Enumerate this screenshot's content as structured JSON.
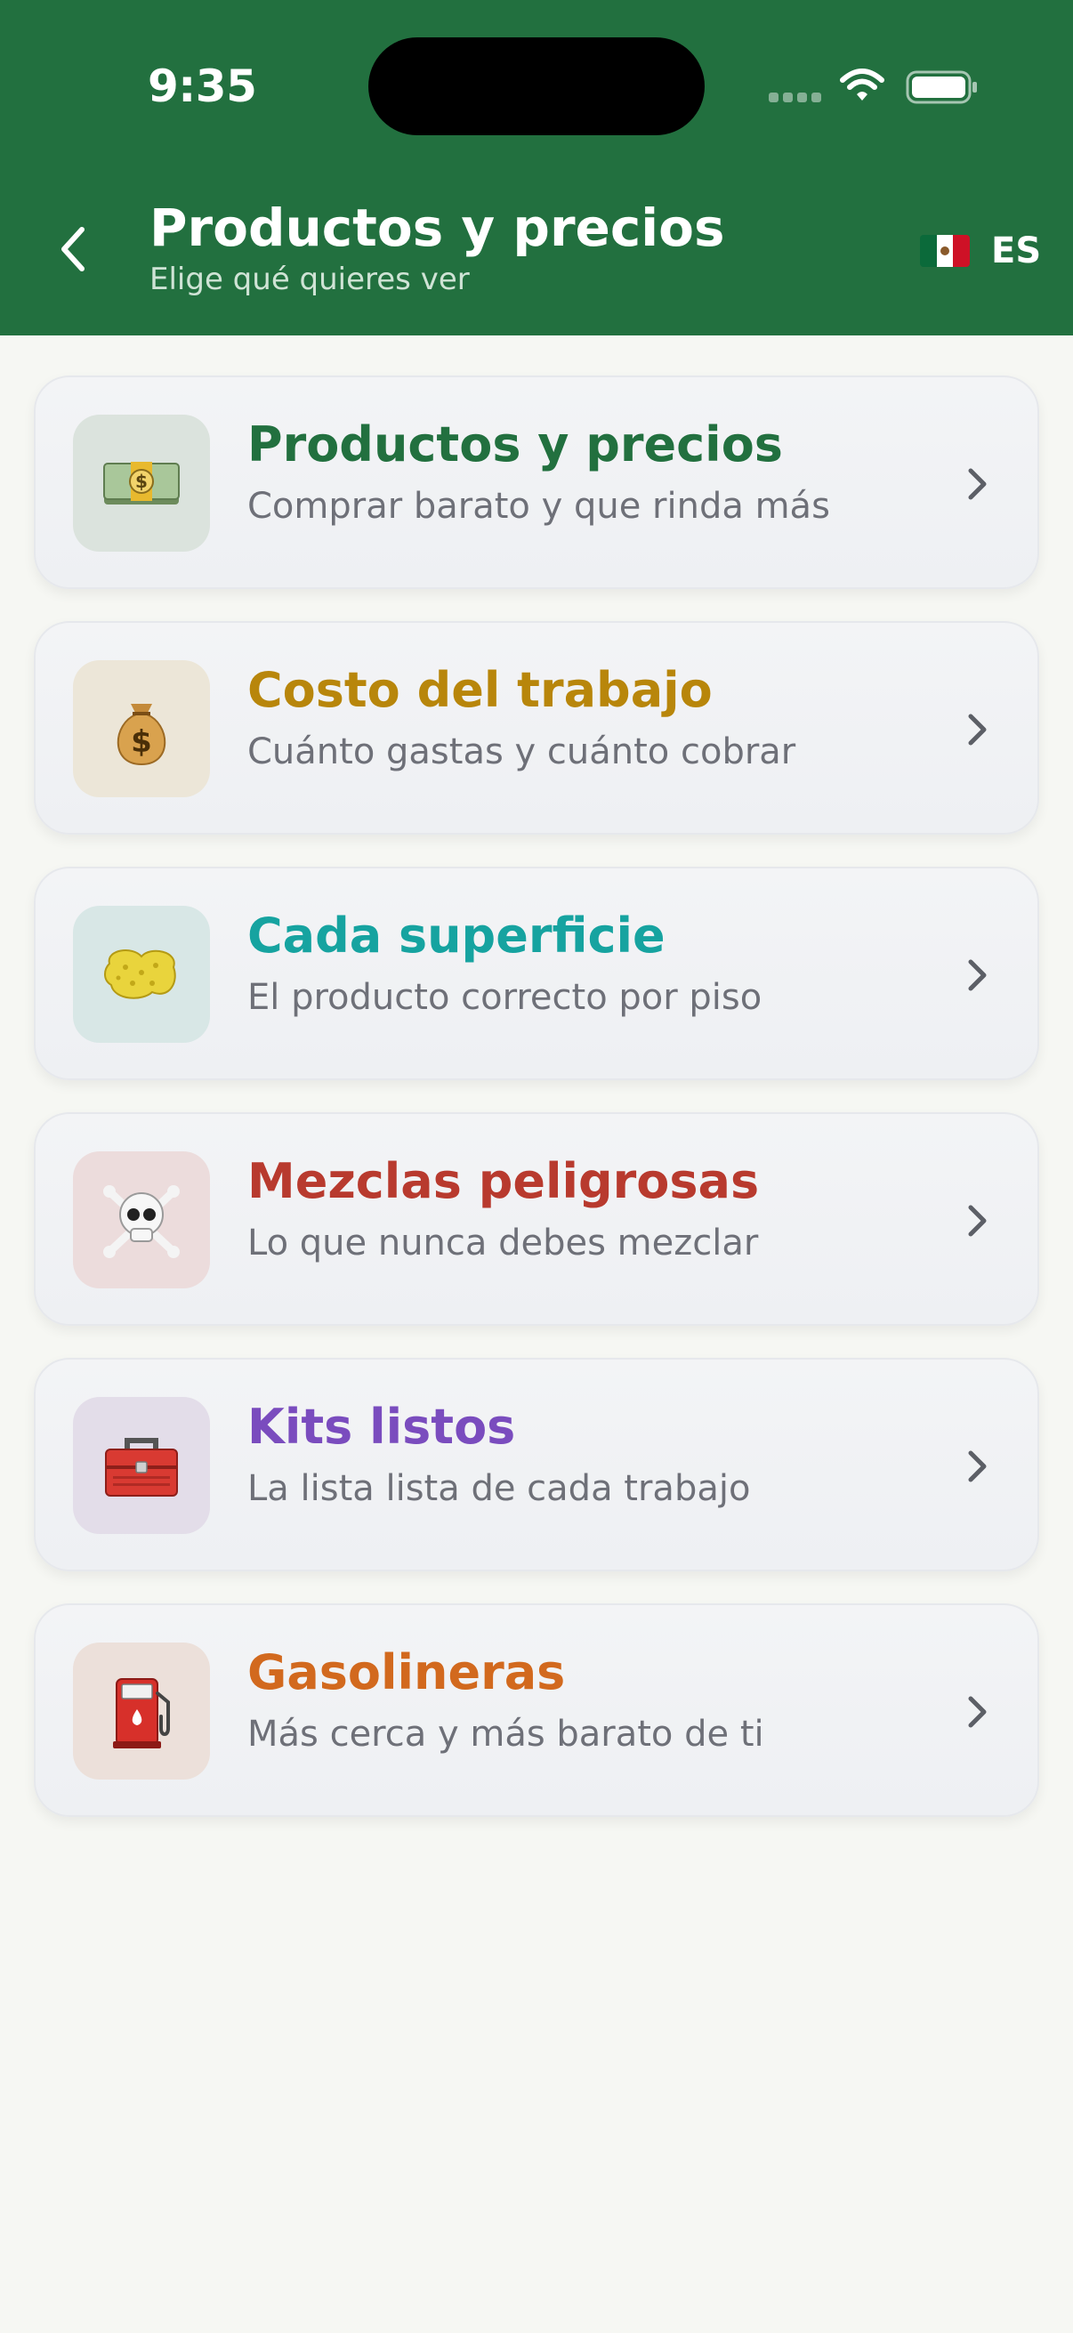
{
  "status_bar": {
    "time": "9:35"
  },
  "header": {
    "title": "Productos y precios",
    "subtitle": "Elige qué quieres ver",
    "language": {
      "code": "ES",
      "flag_icon": "mexico-flag-icon"
    },
    "back_icon": "chevron-left-icon",
    "background": "#22703f"
  },
  "items": [
    {
      "title": "Productos y precios",
      "subtitle": "Comprar barato y que rinda más",
      "icon": "money-icon",
      "color": "#22703f",
      "tile_bg": "#dbe3dd"
    },
    {
      "title": "Costo del trabajo",
      "subtitle": "Cuánto gastas y cuánto cobrar",
      "icon": "money-bag-icon",
      "color": "#b8860b",
      "tile_bg": "#ece6d8"
    },
    {
      "title": "Cada superficie",
      "subtitle": "El producto correcto por piso",
      "icon": "sponge-icon",
      "color": "#16a3a0",
      "tile_bg": "#d8e7e6"
    },
    {
      "title": "Mezclas peligrosas",
      "subtitle": "Lo que nunca debes mezclar",
      "icon": "skull-crossbones-icon",
      "color": "#b83a2e",
      "tile_bg": "#ecdcdc"
    },
    {
      "title": "Kits listos",
      "subtitle": "La lista lista de cada trabajo",
      "icon": "toolbox-icon",
      "color": "#7a4cbe",
      "tile_bg": "#e3dde9"
    },
    {
      "title": "Gasolineras",
      "subtitle": "Más cerca y más barato de ti",
      "icon": "fuel-pump-icon",
      "color": "#d2691e",
      "tile_bg": "#ece0da"
    }
  ]
}
